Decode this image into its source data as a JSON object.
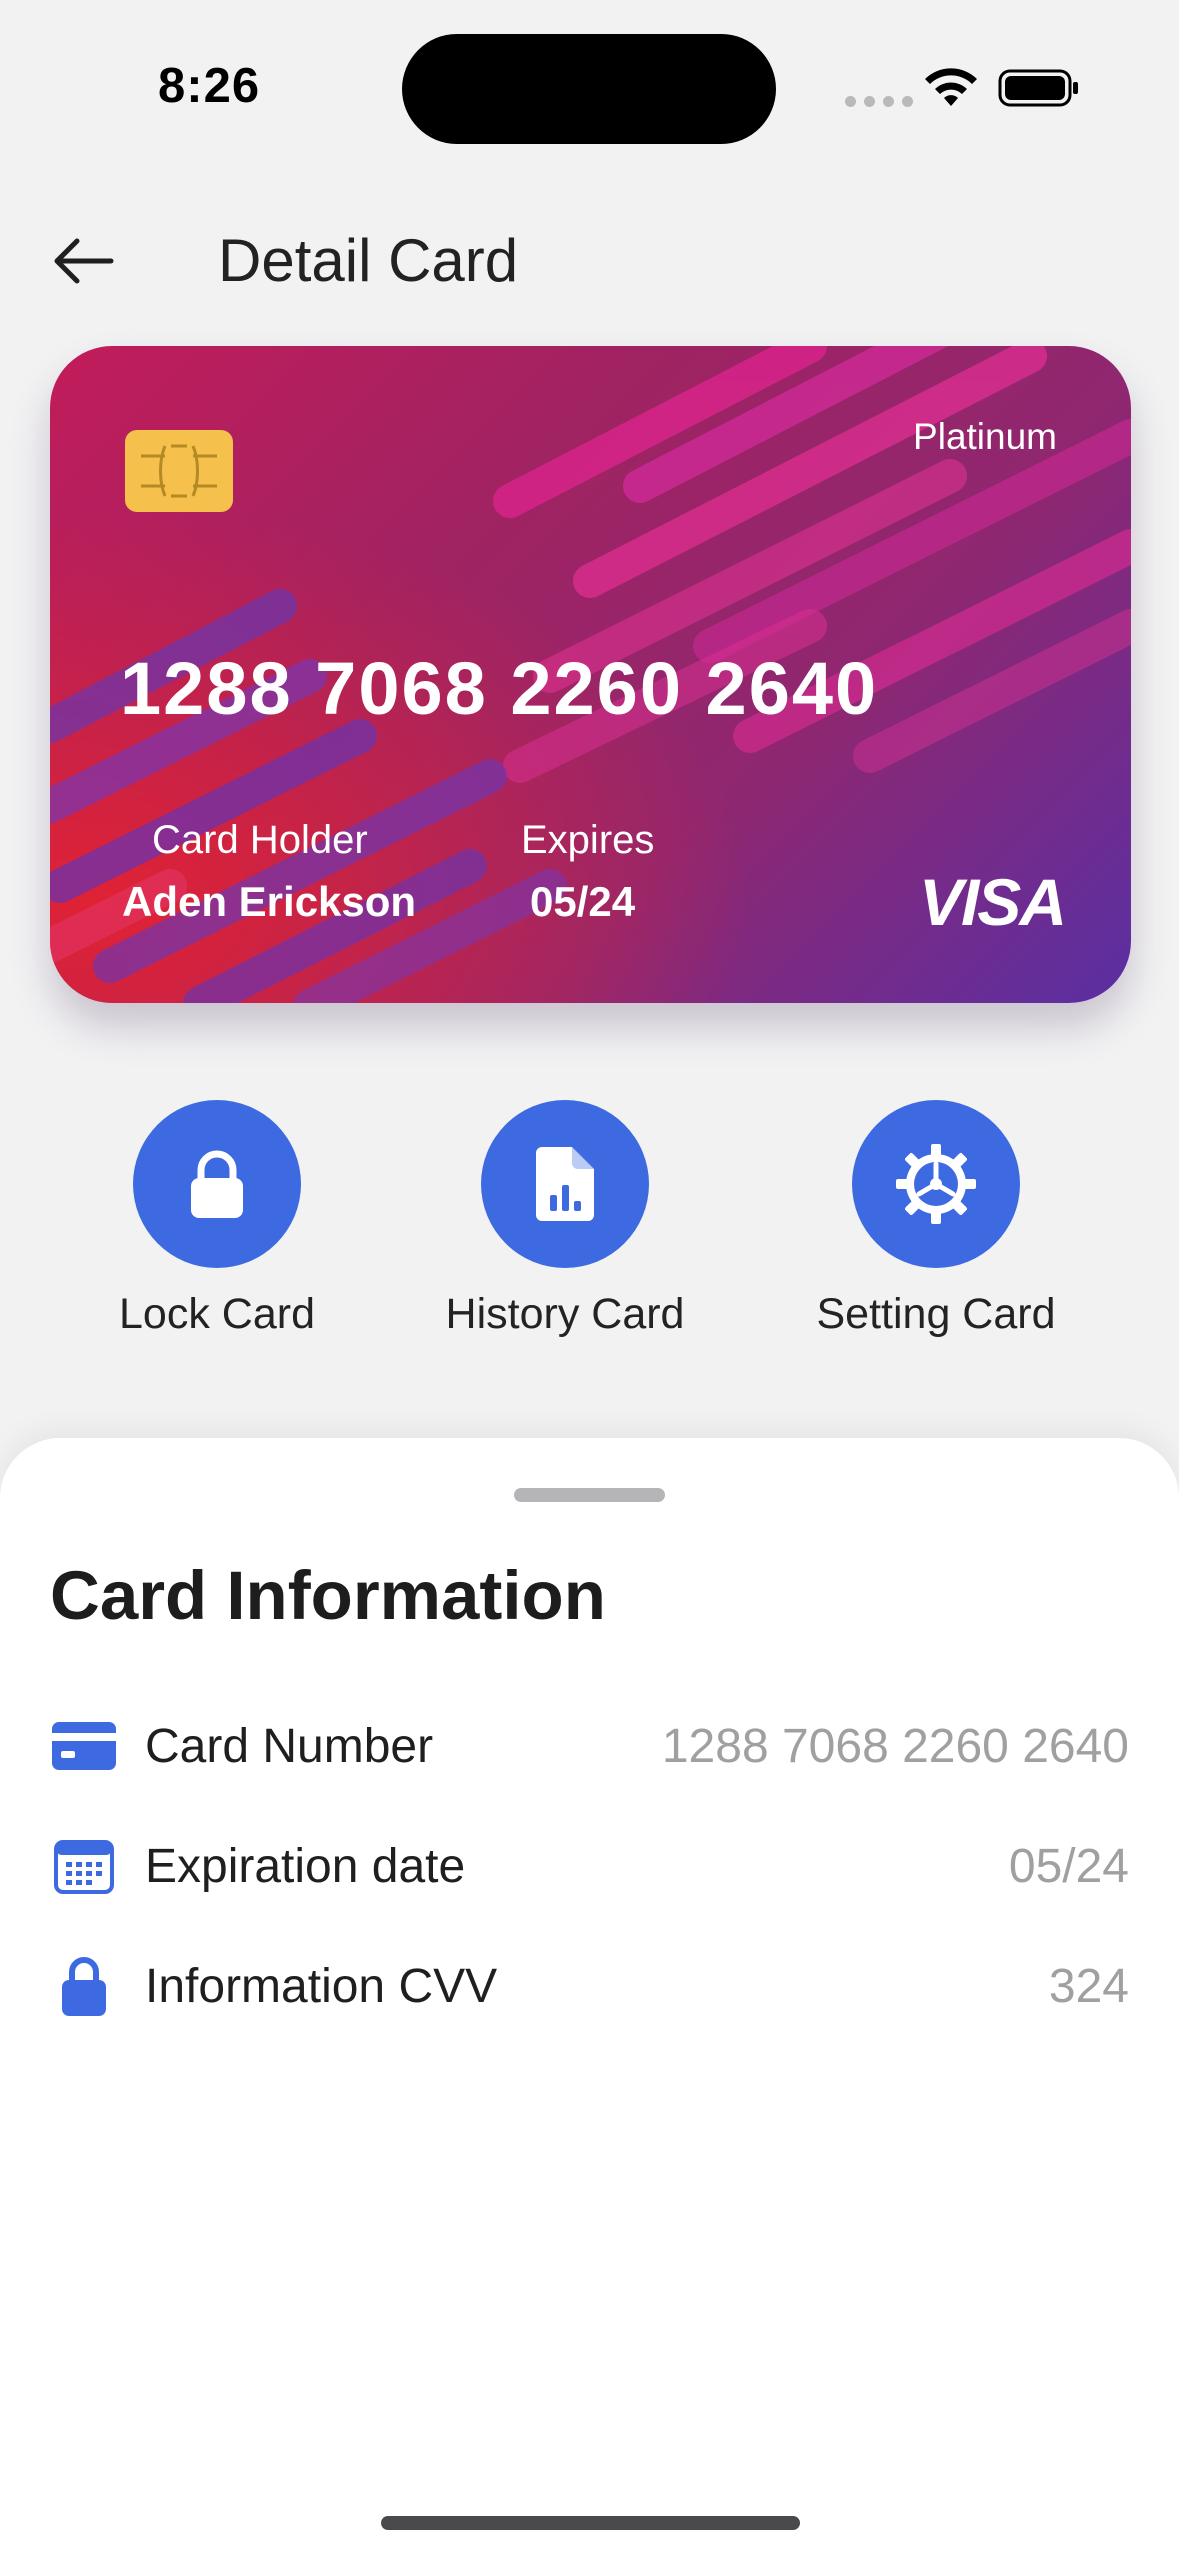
{
  "status_bar": {
    "time": "8:26"
  },
  "header": {
    "title": "Detail Card",
    "back_icon": "arrow-left-icon"
  },
  "card": {
    "tier": "Platinum",
    "number": "1288 7068 2260 2640",
    "holder_label": "Card Holder",
    "holder_name": "Aden Erickson",
    "expires_label": "Expires",
    "expires_value": "05/24",
    "brand": "VISA",
    "colors": {
      "start": "#c21c5a",
      "end": "#5a2fa3",
      "chip": "#f6c04d"
    }
  },
  "actions": [
    {
      "label": "Lock Card",
      "icon": "lock-icon"
    },
    {
      "label": "History Card",
      "icon": "document-chart-icon"
    },
    {
      "label": "Setting Card",
      "icon": "gear-icon"
    }
  ],
  "accent_color": "#3d6ae0",
  "sheet": {
    "title": "Card Information",
    "rows": [
      {
        "label": "Card Number",
        "value": "1288 7068 2260 2640",
        "icon": "credit-card-icon"
      },
      {
        "label": "Expiration date",
        "value": "05/24",
        "icon": "calendar-icon"
      },
      {
        "label": "Information CVV",
        "value": "324",
        "icon": "lock-icon"
      }
    ]
  }
}
